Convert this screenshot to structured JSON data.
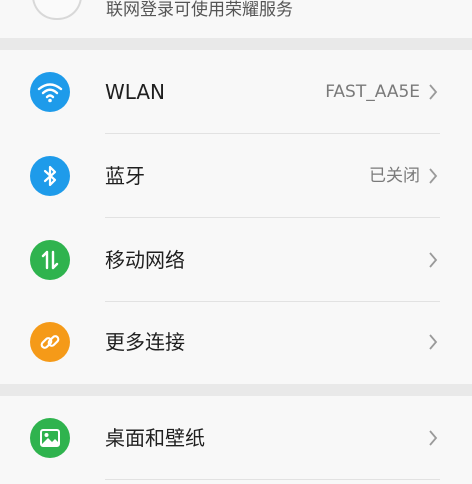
{
  "account": {
    "subtitle": "联网登录可使用荣耀服务"
  },
  "settings": {
    "items": [
      {
        "label": "WLAN",
        "value": "FAST_AA5E",
        "icon": "wifi-icon",
        "color": "#1e9bea"
      },
      {
        "label": "蓝牙",
        "value": "已关闭",
        "icon": "bluetooth-icon",
        "color": "#1e9bea"
      },
      {
        "label": "移动网络",
        "value": "",
        "icon": "mobile-data-icon",
        "color": "#2fb34e"
      },
      {
        "label": "更多连接",
        "value": "",
        "icon": "link-icon",
        "color": "#f59a18"
      },
      {
        "label": "桌面和壁纸",
        "value": "",
        "icon": "image-icon",
        "color": "#2fb34e"
      }
    ]
  }
}
